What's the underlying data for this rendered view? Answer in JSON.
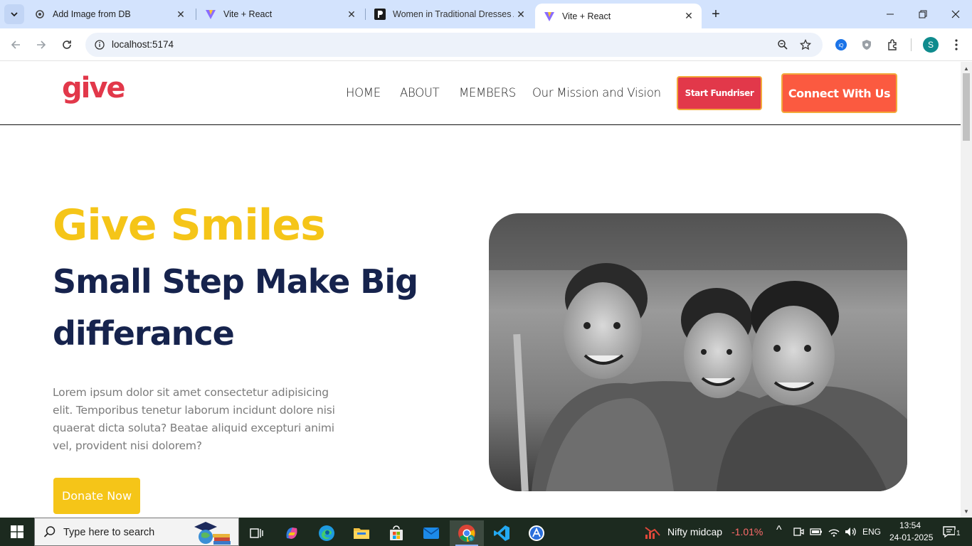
{
  "browser": {
    "tabs": [
      {
        "title": "Add Image from DB",
        "icon": "gear-favicon",
        "active": false
      },
      {
        "title": "Vite + React",
        "icon": "vite-favicon",
        "active": false
      },
      {
        "title": "Women in Traditional Dresses A",
        "icon": "p-favicon",
        "active": false
      },
      {
        "title": "Vite + React",
        "icon": "vite-favicon",
        "active": true
      }
    ],
    "url": "localhost:5174",
    "profile_initial": "S"
  },
  "site": {
    "logo": "give",
    "nav": [
      "HOME",
      "ABOUT",
      "MEMBERS",
      "Our Mission and Vision"
    ],
    "start_fundraiser": "Start Fundriser",
    "connect": "Connect With Us",
    "colors": {
      "brand_red": "#e2384a",
      "accent_yellow": "#f5c518",
      "heading_navy": "#16234d",
      "orange": "#fb5a40"
    }
  },
  "hero": {
    "title": "Give Smiles",
    "subtitle": "Small Step Make Big differance",
    "text": "Lorem ipsum dolor sit amet consectetur adipisicing elit. Temporibus tenetur laborum incidunt dolore nisi quaerat dicta soluta? Beatae aliquid excepturi animi vel, provident nisi dolorem?",
    "donate_button": "Donate Now"
  },
  "taskbar": {
    "search_placeholder": "Type here to search",
    "stock_name": "Nifty midcap",
    "stock_change": "-1.01%",
    "language": "ENG",
    "time": "13:54",
    "date": "24-01-2025",
    "notification_count": "1"
  }
}
